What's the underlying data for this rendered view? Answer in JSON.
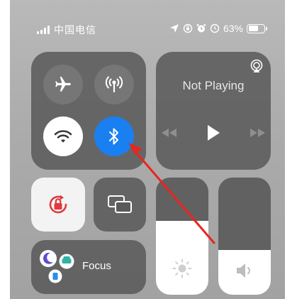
{
  "status_bar": {
    "carrier": "中国电信",
    "battery_percent": "63%",
    "battery_level": 0.63,
    "icons": [
      "signal-bars-icon",
      "location-arrow-icon",
      "screen-lock-rotation-icon",
      "alarm-icon",
      "screen-time-icon",
      "battery-icon"
    ]
  },
  "connectivity": {
    "airplane_mode": {
      "icon": "airplane-icon",
      "state": "off"
    },
    "cellular_data": {
      "icon": "cellular-antenna-icon",
      "state": "off"
    },
    "wifi": {
      "icon": "wifi-icon",
      "state": "on"
    },
    "bluetooth": {
      "icon": "bluetooth-icon",
      "state": "on",
      "color": "#1a7ff0"
    }
  },
  "now_playing": {
    "title": "Not Playing",
    "icons": [
      "airplay-icon",
      "rewind-icon",
      "play-icon",
      "fast-forward-icon"
    ]
  },
  "rotation_lock": {
    "icon": "rotation-lock-icon",
    "state": "on",
    "color": "#e0393e"
  },
  "screen_mirroring": {
    "icon": "screen-mirroring-icon"
  },
  "focus": {
    "label": "Focus",
    "icons": [
      "moon-icon",
      "car-icon",
      "person-badge-icon"
    ]
  },
  "brightness": {
    "icon": "sun-icon",
    "level": 0.63
  },
  "volume": {
    "icon": "speaker-icon",
    "level": 0.38
  },
  "annotation": {
    "arrow_color": "#e8251f",
    "points_to": "bluetooth"
  }
}
